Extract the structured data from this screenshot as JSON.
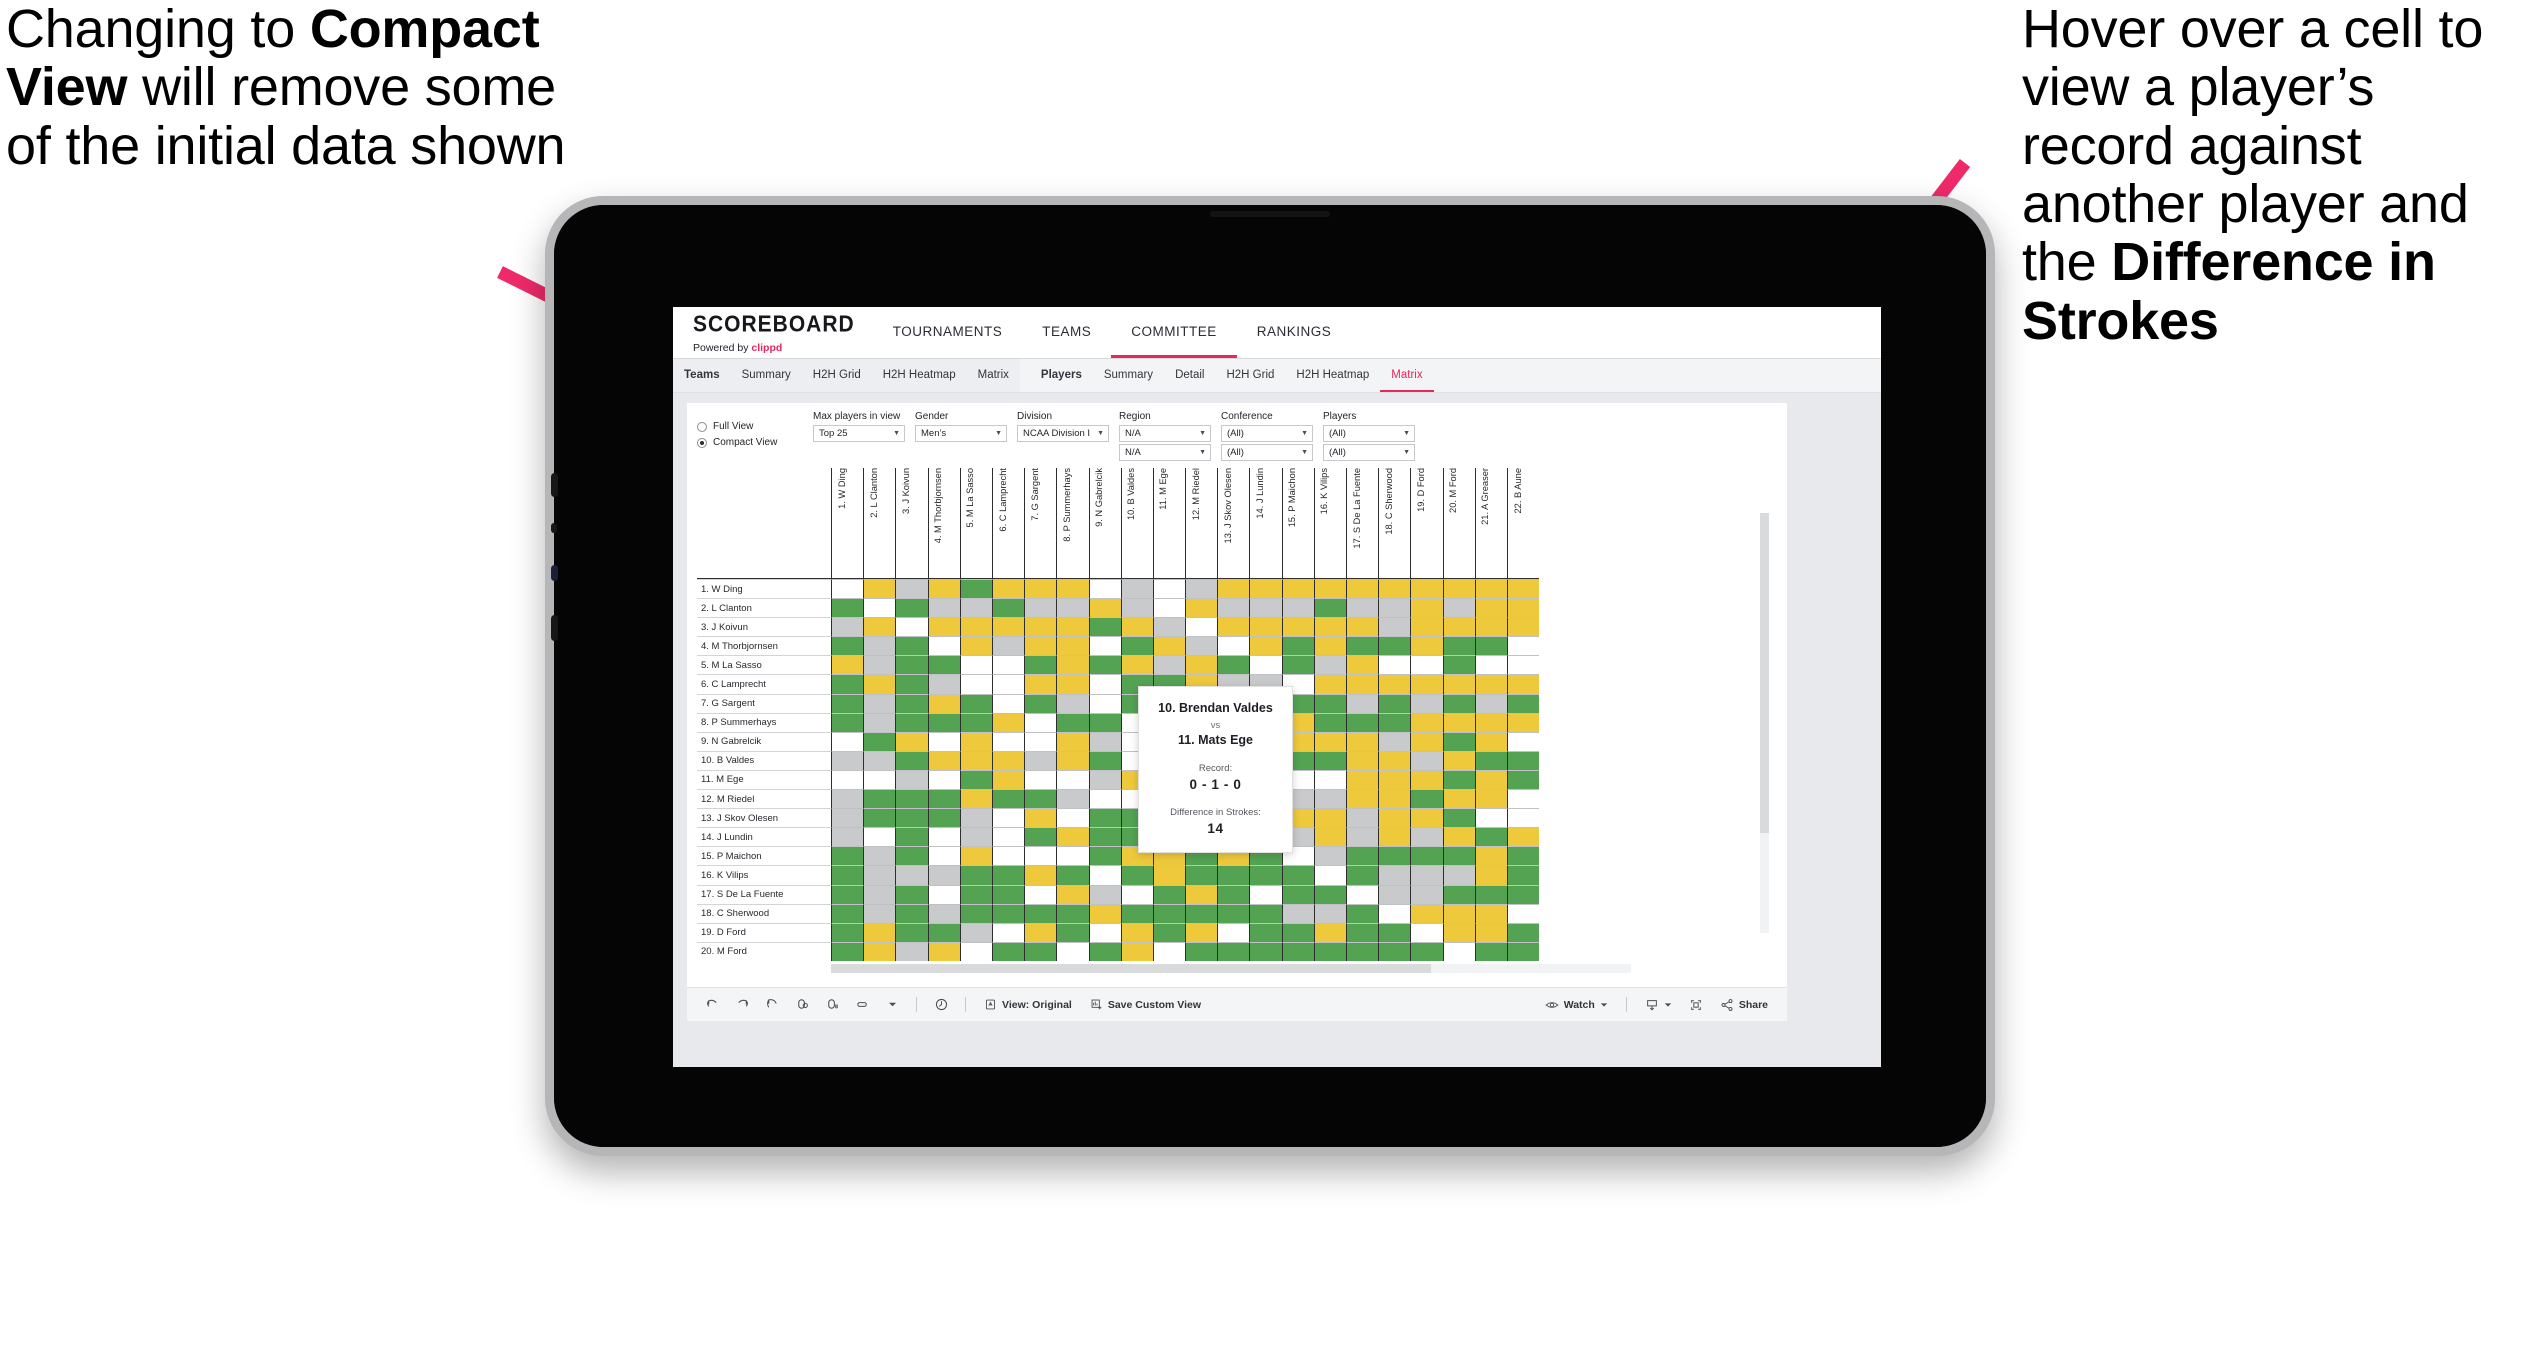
{
  "annotations": {
    "left": {
      "line1": "Changing to ",
      "bold": "Compact View",
      "line2": " will remove some of the initial data shown"
    },
    "right": {
      "line1": "Hover over a cell to view a player’s record against another player and the ",
      "bold": "Difference in Strokes"
    },
    "arrow_color": "#ef2a6b"
  },
  "app": {
    "brand": {
      "title": "SCOREBOARD",
      "powered_prefix": "Powered by ",
      "powered_brand": "clippd"
    },
    "topnav": [
      {
        "label": "TOURNAMENTS",
        "active": false
      },
      {
        "label": "TEAMS",
        "active": false
      },
      {
        "label": "COMMITTEE",
        "active": true
      },
      {
        "label": "RANKINGS",
        "active": false
      }
    ],
    "subnav_group1": [
      {
        "label": "Teams",
        "bold": true,
        "active": false
      },
      {
        "label": "Summary",
        "bold": false,
        "active": false
      },
      {
        "label": "H2H Grid",
        "bold": false,
        "active": false
      },
      {
        "label": "H2H Heatmap",
        "bold": false,
        "active": false
      },
      {
        "label": "Matrix",
        "bold": false,
        "active": false
      }
    ],
    "subnav_group2": [
      {
        "label": "Players",
        "bold": true,
        "active": false
      },
      {
        "label": "Summary",
        "bold": false,
        "active": false
      },
      {
        "label": "Detail",
        "bold": false,
        "active": false
      },
      {
        "label": "H2H Grid",
        "bold": false,
        "active": false
      },
      {
        "label": "H2H Heatmap",
        "bold": false,
        "active": false
      },
      {
        "label": "Matrix",
        "bold": false,
        "active": true
      }
    ]
  },
  "filters": {
    "view_mode": [
      {
        "label": "Full View",
        "selected": false
      },
      {
        "label": "Compact View",
        "selected": true
      }
    ],
    "max_players": {
      "label": "Max players in view",
      "value": "Top 25"
    },
    "gender": {
      "label": "Gender",
      "value": "Men’s"
    },
    "division": {
      "label": "Division",
      "value": "NCAA Division I"
    },
    "region": {
      "label": "Region",
      "value": "N/A",
      "value2": "N/A"
    },
    "conference": {
      "label": "Conference",
      "value": "(All)",
      "value2": "(All)"
    },
    "players": {
      "label": "Players",
      "value": "(All)",
      "value2": "(All)"
    }
  },
  "tooltip": {
    "player_a": "10. Brendan Valdes",
    "vs": "vs",
    "player_b": "11. Mats Ege",
    "record_label": "Record:",
    "record_value": "0 - 1 - 0",
    "diff_label": "Difference in Strokes:",
    "diff_value": "14"
  },
  "toolbar": {
    "icons": [
      "undo-icon",
      "redo-icon",
      "revert-icon",
      "refresh-icon",
      "pause-icon",
      "highlight-icon",
      "caret-down-icon",
      "slow-icon"
    ],
    "view_label": "View: Original",
    "save_label": "Save Custom View",
    "watch_label": "Watch",
    "share_label": "Share"
  },
  "chart_data": {
    "type": "heatmap",
    "title": "Head-to-Head Matrix",
    "legend": {
      "win": "#54a353",
      "loss": "#eec93c",
      "tie": "#c9cacb",
      "none": "#ffffff"
    },
    "row_labels": [
      "1. W Ding",
      "2. L Clanton",
      "3. J Koivun",
      "4. M Thorbjornsen",
      "5. M La Sasso",
      "6. C Lamprecht",
      "7. G Sargent",
      "8. P Summerhays",
      "9. N Gabrelcik",
      "10. B Valdes",
      "11. M Ege",
      "12. M Riedel",
      "13. J Skov Olesen",
      "14. J Lundin",
      "15. P Maichon",
      "16. K Vilips",
      "17. S De La Fuente",
      "18. C Sherwood",
      "19. D Ford",
      "20. M Ford"
    ],
    "col_labels": [
      "1. W Ding",
      "2. L Clanton",
      "3. J Koivun",
      "4. M Thorbjornsen",
      "5. M La Sasso",
      "6. C Lamprecht",
      "7. G Sargent",
      "8. P Summerhays",
      "9. N Gabrelcik",
      "10. B Valdes",
      "11. M Ege",
      "12. M Riedel",
      "13. J Skov Olesen",
      "14. J Lundin",
      "15. P Maichon",
      "16. K Vilips",
      "17. S De La Fuente",
      "18. C Sherwood",
      "19. D Ford",
      "20. M Ford",
      "21. A Greaser",
      "22. B Aune"
    ],
    "cells": [
      [
        "w",
        "y",
        "a",
        "y",
        "g",
        "y",
        "y",
        "y",
        "w",
        "a",
        "w",
        "a",
        "y",
        "y",
        "y",
        "y",
        "y",
        "y",
        "y",
        "y",
        "y",
        "y"
      ],
      [
        "g",
        "w",
        "g",
        "a",
        "a",
        "g",
        "a",
        "a",
        "y",
        "a",
        "w",
        "y",
        "a",
        "a",
        "a",
        "g",
        "a",
        "a",
        "y",
        "a",
        "y",
        "y"
      ],
      [
        "a",
        "y",
        "w",
        "y",
        "y",
        "y",
        "y",
        "y",
        "g",
        "y",
        "a",
        "w",
        "y",
        "y",
        "y",
        "y",
        "y",
        "a",
        "y",
        "y",
        "y",
        "y"
      ],
      [
        "g",
        "a",
        "g",
        "w",
        "y",
        "a",
        "y",
        "y",
        "w",
        "g",
        "y",
        "a",
        "w",
        "y",
        "g",
        "y",
        "g",
        "g",
        "y",
        "g",
        "g",
        "w"
      ],
      [
        "y",
        "a",
        "g",
        "g",
        "w",
        "w",
        "g",
        "y",
        "g",
        "y",
        "a",
        "y",
        "g",
        "w",
        "g",
        "a",
        "y",
        "w",
        "w",
        "g",
        "w",
        "w"
      ],
      [
        "g",
        "y",
        "g",
        "a",
        "w",
        "w",
        "y",
        "y",
        "w",
        "g",
        "g",
        "y",
        "a",
        "a",
        "w",
        "y",
        "y",
        "y",
        "y",
        "y",
        "y",
        "y"
      ],
      [
        "g",
        "a",
        "g",
        "y",
        "g",
        "w",
        "g",
        "a",
        "w",
        "g",
        "y",
        "g",
        "y",
        "a",
        "g",
        "g",
        "a",
        "g",
        "a",
        "g",
        "a",
        "g"
      ],
      [
        "g",
        "a",
        "g",
        "g",
        "g",
        "y",
        "w",
        "g",
        "g",
        "w",
        "a",
        "a",
        "g",
        "w",
        "y",
        "g",
        "g",
        "g",
        "y",
        "y",
        "y",
        "y"
      ],
      [
        "w",
        "g",
        "y",
        "w",
        "y",
        "w",
        "w",
        "y",
        "a",
        "w",
        "w",
        "w",
        "g",
        "g",
        "y",
        "y",
        "y",
        "a",
        "y",
        "g",
        "y",
        "w"
      ],
      [
        "a",
        "a",
        "g",
        "y",
        "y",
        "y",
        "a",
        "y",
        "g",
        "w",
        "a",
        "g",
        "y",
        "y",
        "g",
        "g",
        "y",
        "y",
        "a",
        "y",
        "g",
        "g"
      ],
      [
        "w",
        "w",
        "a",
        "w",
        "g",
        "y",
        "w",
        "w",
        "a",
        "y",
        "w",
        "w",
        "g",
        "a",
        "w",
        "w",
        "y",
        "y",
        "y",
        "g",
        "y",
        "g"
      ],
      [
        "a",
        "g",
        "g",
        "g",
        "y",
        "g",
        "g",
        "a",
        "w",
        "w",
        "g",
        "w",
        "y",
        "g",
        "a",
        "a",
        "y",
        "y",
        "g",
        "y",
        "y",
        "w"
      ],
      [
        "a",
        "g",
        "g",
        "g",
        "a",
        "w",
        "y",
        "w",
        "g",
        "g",
        "y",
        "y",
        "w",
        "y",
        "y",
        "y",
        "a",
        "y",
        "y",
        "g",
        "w",
        "w"
      ],
      [
        "a",
        "w",
        "g",
        "w",
        "a",
        "w",
        "g",
        "y",
        "g",
        "g",
        "y",
        "y",
        "y",
        "w",
        "a",
        "y",
        "a",
        "y",
        "a",
        "y",
        "g",
        "y"
      ],
      [
        "g",
        "a",
        "g",
        "w",
        "y",
        "w",
        "w",
        "w",
        "g",
        "y",
        "y",
        "g",
        "y",
        "g",
        "w",
        "a",
        "g",
        "g",
        "g",
        "g",
        "y",
        "g"
      ],
      [
        "g",
        "a",
        "a",
        "a",
        "g",
        "g",
        "y",
        "g",
        "w",
        "g",
        "y",
        "g",
        "g",
        "g",
        "g",
        "w",
        "g",
        "a",
        "a",
        "a",
        "y",
        "g"
      ],
      [
        "g",
        "a",
        "g",
        "w",
        "g",
        "g",
        "w",
        "y",
        "a",
        "w",
        "g",
        "y",
        "g",
        "w",
        "g",
        "g",
        "w",
        "a",
        "a",
        "g",
        "g",
        "g"
      ],
      [
        "g",
        "a",
        "g",
        "a",
        "g",
        "g",
        "g",
        "g",
        "y",
        "g",
        "g",
        "g",
        "g",
        "g",
        "a",
        "a",
        "g",
        "w",
        "y",
        "y",
        "y",
        "w"
      ],
      [
        "g",
        "y",
        "g",
        "g",
        "a",
        "w",
        "y",
        "g",
        "w",
        "y",
        "g",
        "y",
        "w",
        "g",
        "g",
        "y",
        "g",
        "g",
        "w",
        "y",
        "y",
        "g"
      ],
      [
        "g",
        "y",
        "a",
        "y",
        "w",
        "g",
        "g",
        "w",
        "g",
        "y",
        "w",
        "g",
        "g",
        "g",
        "g",
        "g",
        "g",
        "g",
        "g",
        "w",
        "g",
        "g"
      ]
    ],
    "highlighted_cell": {
      "row": "10. B Valdes",
      "col": "11. M Ege"
    }
  }
}
